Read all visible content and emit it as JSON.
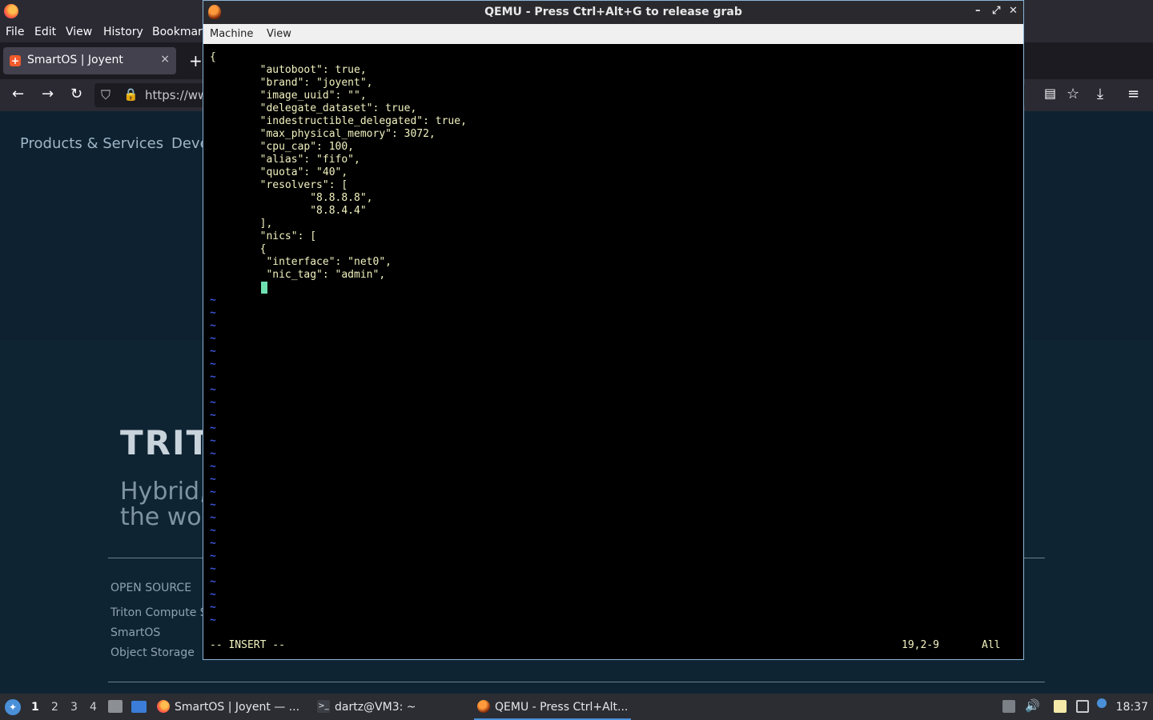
{
  "firefox": {
    "menu": [
      "File",
      "Edit",
      "View",
      "History",
      "Bookmarks"
    ],
    "tab_title": "SmartOS | Joyent",
    "tab_close": "×",
    "new_tab": "+",
    "url": "https://ww"
  },
  "webpage": {
    "nav": [
      "Products & Services",
      "Deve"
    ],
    "logo_text": "TRIT",
    "hero_line1": "Hybrid,",
    "hero_line2": "the wor",
    "footer_heading": "OPEN SOURCE",
    "footer_links": [
      "Triton Compute Se",
      "SmartOS",
      "Object Storage"
    ]
  },
  "qemu": {
    "title": "QEMU - Press Ctrl+Alt+G to release grab",
    "menu": [
      "Machine",
      "View"
    ],
    "controls": {
      "minimize": "–",
      "maximize": "⤢",
      "close": "✕"
    },
    "editor_lines": [
      "{",
      "        \"autoboot\": true,",
      "        \"brand\": \"joyent\",",
      "        \"image_uuid\": \"\",",
      "        \"delegate_dataset\": true,",
      "        \"indestructible_delegated\": true,",
      "        \"max_physical_memory\": 3072,",
      "        \"cpu_cap\": 100,",
      "        \"alias\": \"fifo\",",
      "        \"quota\": \"40\",",
      "        \"resolvers\": [",
      "                \"8.8.8.8\",",
      "                \"8.8.4.4\"",
      "        ],",
      "        \"nics\": [",
      "        {",
      "         \"interface\": \"net0\",",
      "         \"nic_tag\": \"admin\","
    ],
    "tilde": "~",
    "status_mode": "-- INSERT --",
    "status_position": "19,2-9",
    "status_scroll": "All"
  },
  "taskbar": {
    "workspaces": [
      "1",
      "2",
      "3",
      "4"
    ],
    "tasks": [
      "SmartOS | Joyent — ...",
      "dartz@VM3: ~",
      "QEMU - Press Ctrl+Alt..."
    ],
    "clock": "18:37"
  }
}
